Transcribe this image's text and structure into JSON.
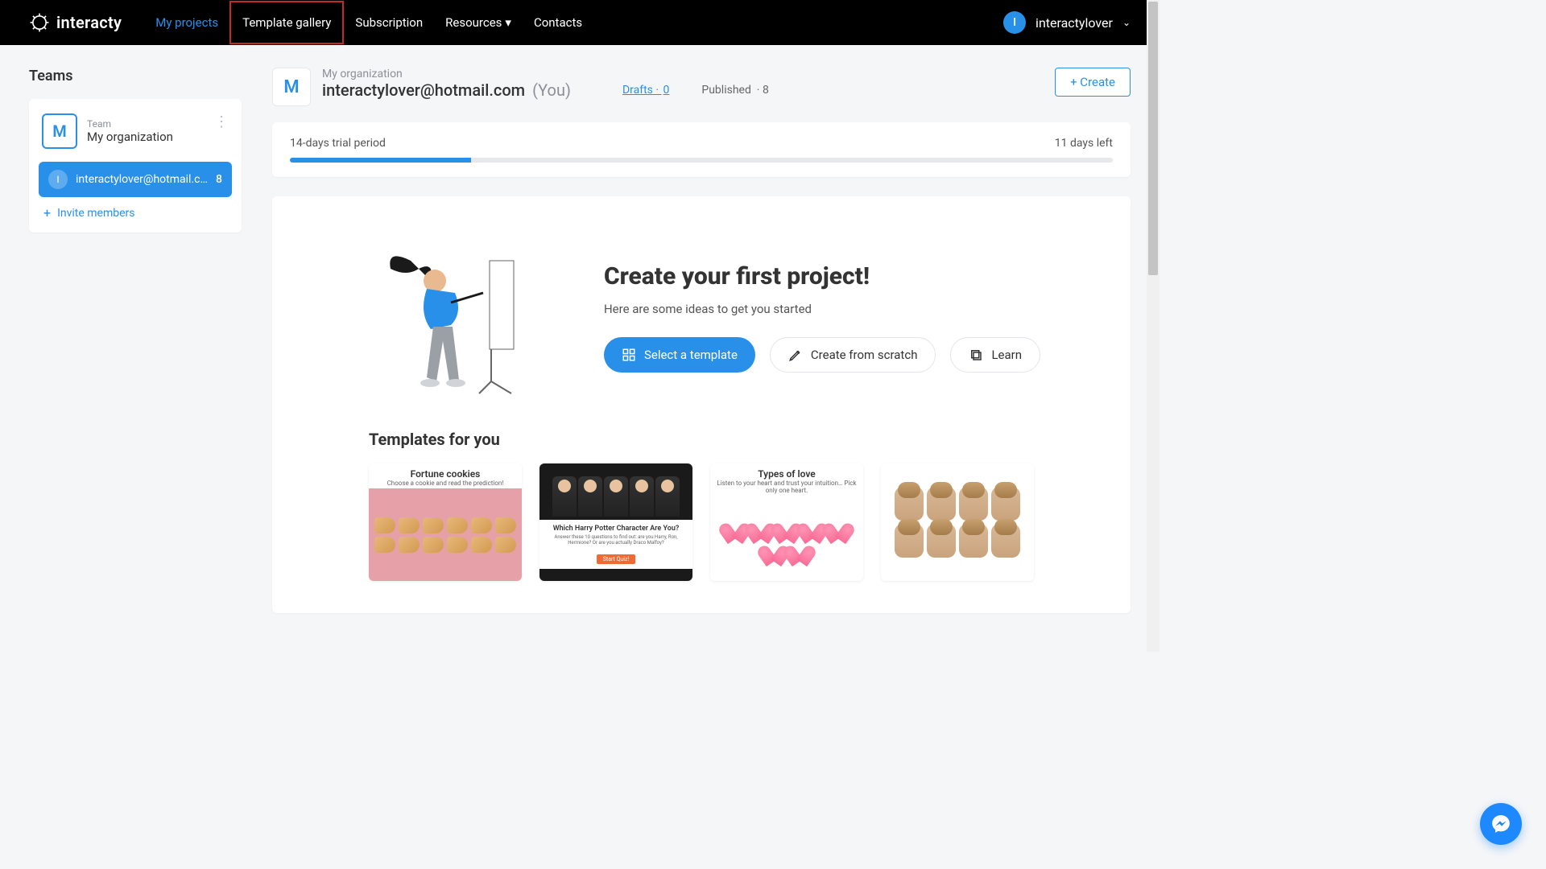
{
  "brand": "interacty",
  "nav": {
    "my_projects": "My projects",
    "template_gallery": "Template gallery",
    "subscription": "Subscription",
    "resources": "Resources",
    "contacts": "Contacts"
  },
  "user": {
    "avatar_letter": "I",
    "name": "interactylover"
  },
  "sidebar": {
    "heading": "Teams",
    "team_label": "Team",
    "team_name": "My organization",
    "team_letter": "M",
    "member_letter": "I",
    "member_email": "interactylover@hotmail.com…",
    "member_count": "8",
    "invite": "Invite members"
  },
  "org": {
    "avatar_letter": "M",
    "label": "My organization",
    "email": "interactylover@hotmail.com",
    "you": "(You)",
    "drafts_label": "Drafts",
    "drafts_count": "0",
    "published_label": "Published",
    "published_count": "8",
    "create": "+ Create"
  },
  "trial": {
    "label": "14-days trial period",
    "remaining": "11 days left"
  },
  "hero": {
    "title": "Create your first project!",
    "subtitle": "Here are some ideas to get you started",
    "select_template": "Select a template",
    "create_scratch": "Create from scratch",
    "learn": "Learn"
  },
  "templates": {
    "heading": "Templates for you",
    "t1_title": "Fortune cookies",
    "t1_sub": "Choose a cookie and read the prediction!",
    "t2_question": "Which Harry Potter Character Are You?",
    "t2_desc": "Answer these 10 questions to find out: are you Harry, Ron, Hermione? Or are you actually Draco Malfoy?",
    "t2_btn": "Start Quiz!",
    "t3_title": "Types of love",
    "t3_sub": "Listen to your heart and trust your intuition… Pick only one heart."
  }
}
